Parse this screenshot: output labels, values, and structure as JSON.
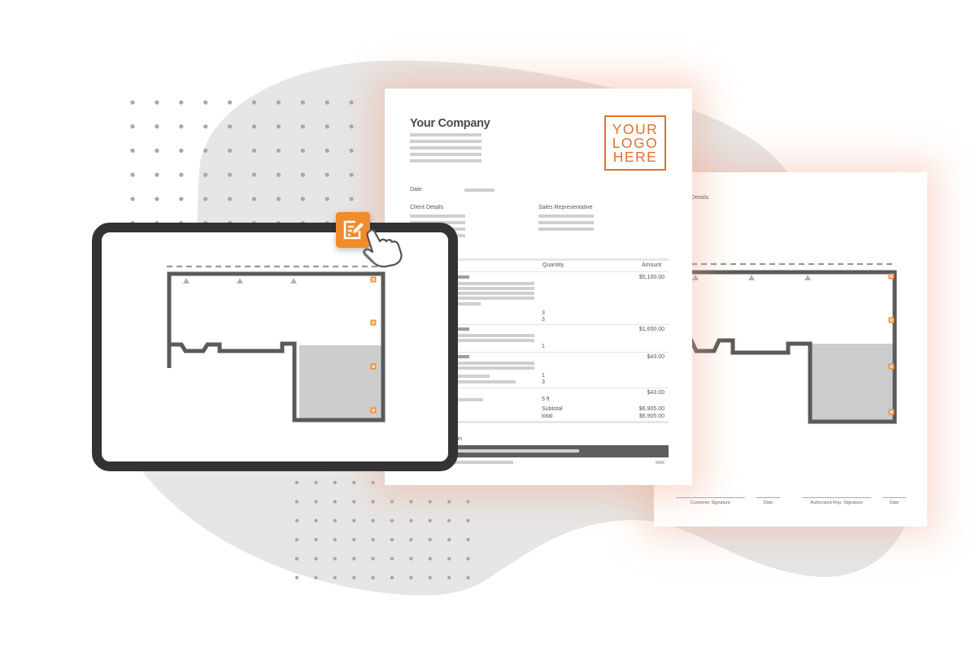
{
  "colors": {
    "accent_orange": "#f08c2a",
    "logo_orange": "#e07030",
    "tablet_frame": "#333333",
    "blob_gray": "#e6e6e6",
    "dot_gray": "#a8a8a8",
    "wall_gray": "#5a5a5a",
    "shaded_area": "#cccccc"
  },
  "invoice": {
    "company_name": "Your Company",
    "logo_lines": [
      "YOUR",
      "LOGO",
      "HERE"
    ],
    "date_label": "Date",
    "client_details_label": "Client Details",
    "sales_rep_label": "Sales Representative",
    "columns": {
      "quantity": "Quantity",
      "amount": "Amount"
    },
    "line_items": [
      {
        "amount": "$5,100.00",
        "quantities": [
          "3",
          "3"
        ]
      },
      {
        "amount": "$1,650.00",
        "quantities": [
          "1"
        ]
      },
      {
        "amount": "$43.00",
        "quantities": [
          "1",
          "3"
        ]
      },
      {
        "amount": "$43.00",
        "quantities": [
          "5 ft"
        ]
      }
    ],
    "subtotal_label": "Subtotal",
    "subtotal_value": "$6,905.00",
    "total_label": "total",
    "total_value": "$6,905.00",
    "section_label_partial": "ation"
  },
  "back_document": {
    "details_label_partial": "Details",
    "signatures": [
      {
        "label": "Customer Signature"
      },
      {
        "label": "Date"
      },
      {
        "label": "Authorized Rep. Signature"
      },
      {
        "label": "Date"
      }
    ]
  },
  "tablet": {
    "edit_button_icon": "edit-document-icon",
    "cursor_icon": "pointing-hand-icon"
  }
}
